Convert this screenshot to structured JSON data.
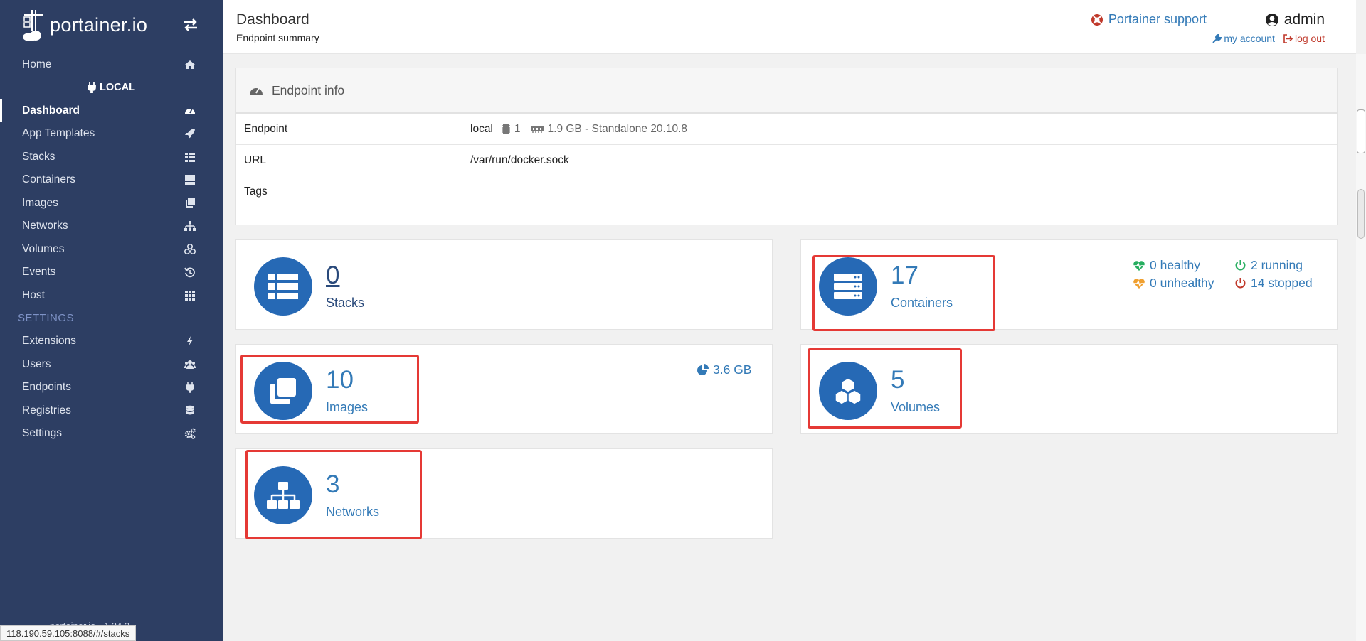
{
  "brand": {
    "logo_text": "portainer.io",
    "version": "1.24.2",
    "footer_text": "portainer.io"
  },
  "sidebar": {
    "home": "Home",
    "endpoint_section": "LOCAL",
    "items": [
      {
        "label": "Dashboard",
        "icon": "tachometer-icon"
      },
      {
        "label": "App Templates",
        "icon": "rocket-icon"
      },
      {
        "label": "Stacks",
        "icon": "th-list-icon"
      },
      {
        "label": "Containers",
        "icon": "server-icon"
      },
      {
        "label": "Images",
        "icon": "clone-icon"
      },
      {
        "label": "Networks",
        "icon": "sitemap-icon"
      },
      {
        "label": "Volumes",
        "icon": "cubes-icon"
      },
      {
        "label": "Events",
        "icon": "history-icon"
      },
      {
        "label": "Host",
        "icon": "th-icon"
      }
    ],
    "settings_heading": "SETTINGS",
    "settings_items": [
      {
        "label": "Extensions",
        "icon": "bolt-icon"
      },
      {
        "label": "Users",
        "icon": "users-icon"
      },
      {
        "label": "Endpoints",
        "icon": "plug-icon"
      },
      {
        "label": "Registries",
        "icon": "database-icon"
      },
      {
        "label": "Settings",
        "icon": "cogs-icon"
      }
    ]
  },
  "header": {
    "title": "Dashboard",
    "subtitle": "Endpoint summary",
    "support": "Portainer support",
    "user": "admin",
    "my_account": "my account",
    "log_out": "log out"
  },
  "endpoint_info": {
    "title": "Endpoint info",
    "rows": {
      "endpoint_key": "Endpoint",
      "endpoint_name": "local",
      "cpu": "1",
      "mem_detail": "1.9 GB - Standalone 20.10.8",
      "url_key": "URL",
      "url_value": "/var/run/docker.sock",
      "tags_key": "Tags"
    }
  },
  "stats": {
    "stacks": {
      "count": "0",
      "label": "Stacks"
    },
    "containers": {
      "count": "17",
      "label": "Containers",
      "healthy": "0 healthy",
      "unhealthy": "0 unhealthy",
      "running": "2 running",
      "stopped": "14 stopped"
    },
    "images": {
      "count": "10",
      "label": "Images",
      "size": "3.6 GB"
    },
    "volumes": {
      "count": "5",
      "label": "Volumes"
    },
    "networks": {
      "count": "3",
      "label": "Networks"
    }
  },
  "statusbar": {
    "url": "118.190.59.105:8088/#/stacks"
  },
  "colors": {
    "sidebar": "#2d3e63",
    "accent": "#2669b5",
    "link": "#337ab7",
    "highlight": "#e53935",
    "healthy": "#27ae60",
    "unhealthy": "#f0a030",
    "stopped": "#c0392b"
  }
}
